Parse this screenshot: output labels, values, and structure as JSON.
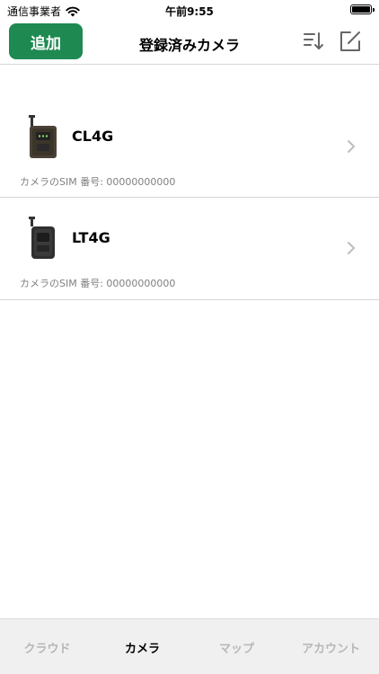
{
  "status_bar": {
    "carrier": "通信事業者",
    "time": "午前9:55",
    "wifi_icon": "wifi-icon",
    "battery_icon": "battery-icon",
    "battery_level": 1.0
  },
  "header": {
    "add_label": "追加",
    "title": "登録済みカメラ",
    "sort_icon": "sort-icon",
    "edit_icon": "edit-icon"
  },
  "cameras": [
    {
      "name": "CL4G",
      "sim_label": "カメラのSIM 番号: ",
      "sim_number": "00000000000",
      "thumbnail_icon": "trail-camera-icon",
      "chevron_icon": "chevron-right-icon"
    },
    {
      "name": "LT4G",
      "sim_label": "カメラのSIM 番号: ",
      "sim_number": "00000000000",
      "thumbnail_icon": "trail-camera-icon",
      "chevron_icon": "chevron-right-icon"
    }
  ],
  "tab_bar": {
    "tabs": [
      {
        "label": "クラウド",
        "active": false
      },
      {
        "label": "カメラ",
        "active": true
      },
      {
        "label": "マップ",
        "active": false
      },
      {
        "label": "アカウント",
        "active": false
      }
    ]
  },
  "colors": {
    "accent": "#1e8a52",
    "tab_inactive": "#b7b7b7",
    "divider": "#d6d6d6"
  }
}
